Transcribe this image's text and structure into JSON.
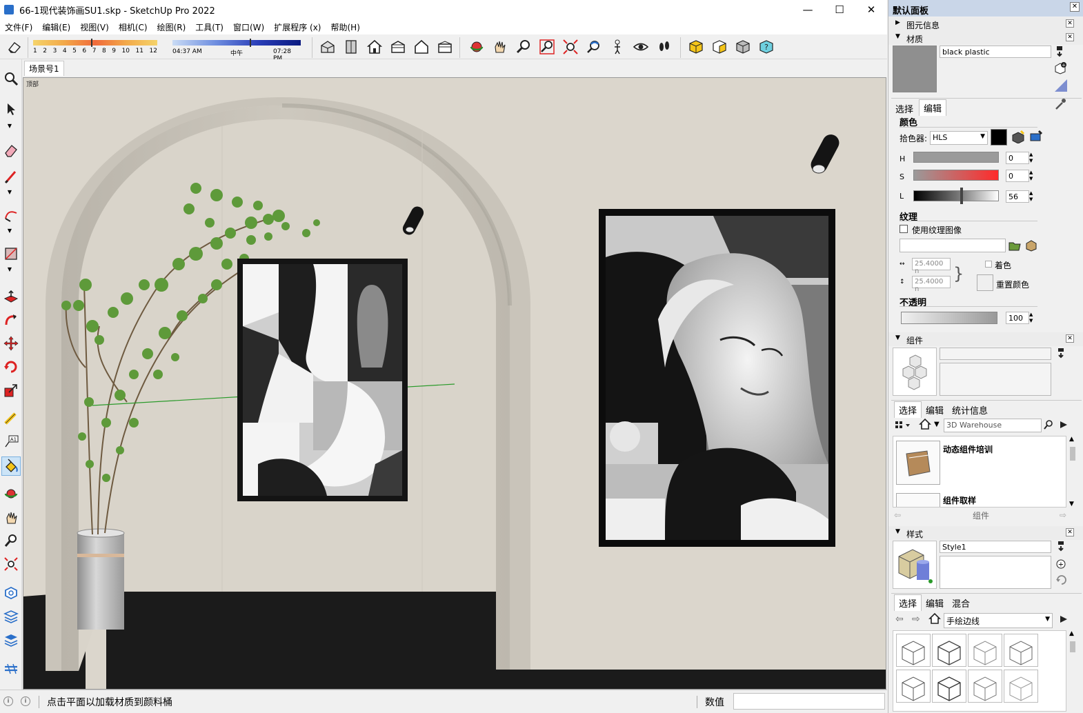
{
  "window": {
    "title": "66-1现代装饰画SU1.skp - SketchUp Pro 2022",
    "minimize_glyph": "—",
    "maximize_glyph": "☐",
    "close_glyph": "✕"
  },
  "menu": [
    "文件(F)",
    "编辑(E)",
    "视图(V)",
    "相机(C)",
    "绘图(R)",
    "工具(T)",
    "窗口(W)",
    "扩展程序 (x)",
    "帮助(H)"
  ],
  "shadow_bar": {
    "months": [
      "1",
      "2",
      "3",
      "4",
      "5",
      "6",
      "7",
      "8",
      "9",
      "10",
      "11",
      "12"
    ],
    "time_start": "04:37 AM",
    "time_mid": "中午",
    "time_end": "07:28 PM"
  },
  "scene_tab": "场景号1",
  "viewport_label": "顶部",
  "status": {
    "message": "点击平面以加载材质到颜料桶",
    "measurements_label": "数值",
    "measurements_value": ""
  },
  "right_panel": {
    "title": "默认面板",
    "entity_info": "图元信息",
    "materials": {
      "header": "材质",
      "name": "black plastic",
      "tabs": [
        "选择",
        "编辑"
      ],
      "color_label": "颜色",
      "picker_label": "拾色器:",
      "picker_value": "HLS",
      "h_label": "H",
      "h_value": "0",
      "s_label": "S",
      "s_value": "0",
      "l_label": "L",
      "l_value": "56",
      "texture_label": "纹理",
      "use_texture": "使用纹理图像",
      "texture_path": "",
      "width": "25.4000 n",
      "height": "25.4000 n",
      "colorize": "着色",
      "reset_color": "重置颜色",
      "opacity_label": "不透明",
      "opacity_value": "100"
    },
    "components": {
      "header": "组件",
      "tabs": [
        "选择",
        "编辑",
        "统计信息"
      ],
      "search_placeholder": "3D Warehouse",
      "items": [
        "动态组件培训",
        "组件取样"
      ],
      "footer": "组件"
    },
    "styles": {
      "header": "样式",
      "name": "Style1",
      "tabs": [
        "选择",
        "编辑",
        "混合"
      ],
      "collection": "手绘边线"
    }
  },
  "colors": {
    "wall": "#dbd6cc",
    "floor": "#1b1b1b",
    "accent": "#e02020"
  }
}
